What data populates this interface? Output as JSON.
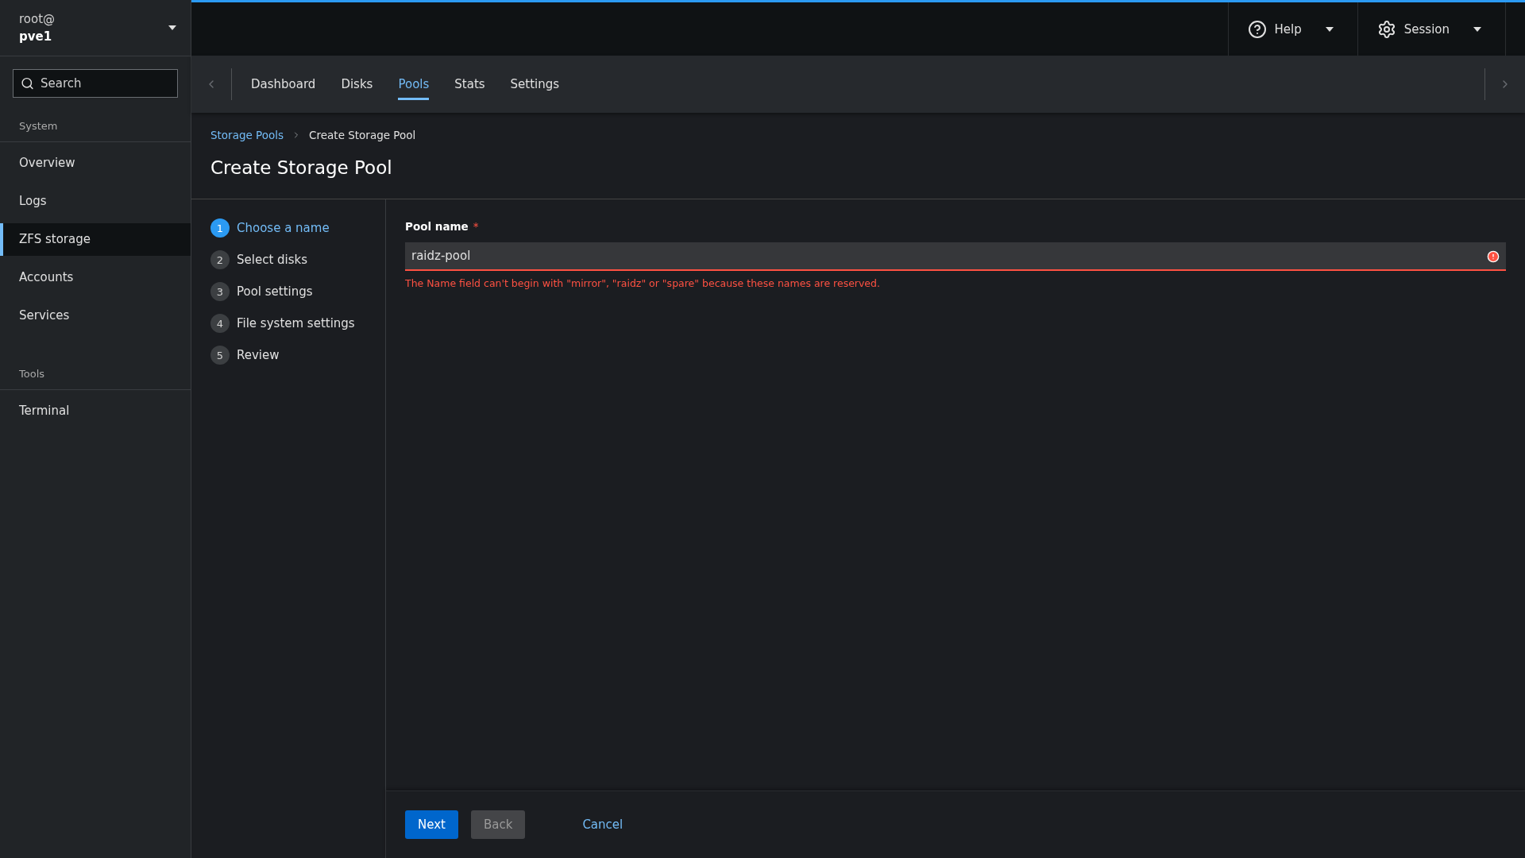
{
  "host": {
    "user": "root@",
    "name": "pve1"
  },
  "search": {
    "placeholder": "Search"
  },
  "nav_sections": [
    {
      "title": "System",
      "items": [
        {
          "label": "Overview",
          "selected": false
        },
        {
          "label": "Logs",
          "selected": false
        },
        {
          "label": "ZFS storage",
          "selected": true
        },
        {
          "label": "Accounts",
          "selected": false
        },
        {
          "label": "Services",
          "selected": false
        }
      ]
    },
    {
      "title": "Tools",
      "items": [
        {
          "label": "Terminal",
          "selected": false
        }
      ]
    }
  ],
  "top_menus": [
    {
      "kind": "help",
      "label": "Help"
    },
    {
      "kind": "session",
      "label": "Session"
    }
  ],
  "tabs": [
    {
      "label": "Dashboard",
      "selected": false
    },
    {
      "label": "Disks",
      "selected": false
    },
    {
      "label": "Pools",
      "selected": true
    },
    {
      "label": "Stats",
      "selected": false
    },
    {
      "label": "Settings",
      "selected": false
    }
  ],
  "breadcrumb": [
    {
      "label": "Storage Pools",
      "kind": "link"
    },
    {
      "label": "Create Storage Pool",
      "kind": "current"
    }
  ],
  "page_title": "Create Storage Pool",
  "steps": [
    {
      "number": "1",
      "label": "Choose a name",
      "selected": true
    },
    {
      "number": "2",
      "label": "Select disks",
      "selected": false
    },
    {
      "number": "3",
      "label": "Pool settings",
      "selected": false
    },
    {
      "number": "4",
      "label": "File system settings",
      "selected": false
    },
    {
      "number": "5",
      "label": "Review",
      "selected": false
    }
  ],
  "field": {
    "label": "Pool name",
    "required_mark": "*",
    "value": "raidz-pool",
    "error": true,
    "error_text": "The Name field can't begin with \"mirror\", \"raidz\" or \"spare\" because these names are reserved."
  },
  "footer": [
    {
      "kind": "primary",
      "label": "Next",
      "disabled": false
    },
    {
      "kind": "secondary",
      "label": "Back",
      "disabled": true
    },
    {
      "kind": "link",
      "label": "Cancel",
      "disabled": false
    }
  ]
}
